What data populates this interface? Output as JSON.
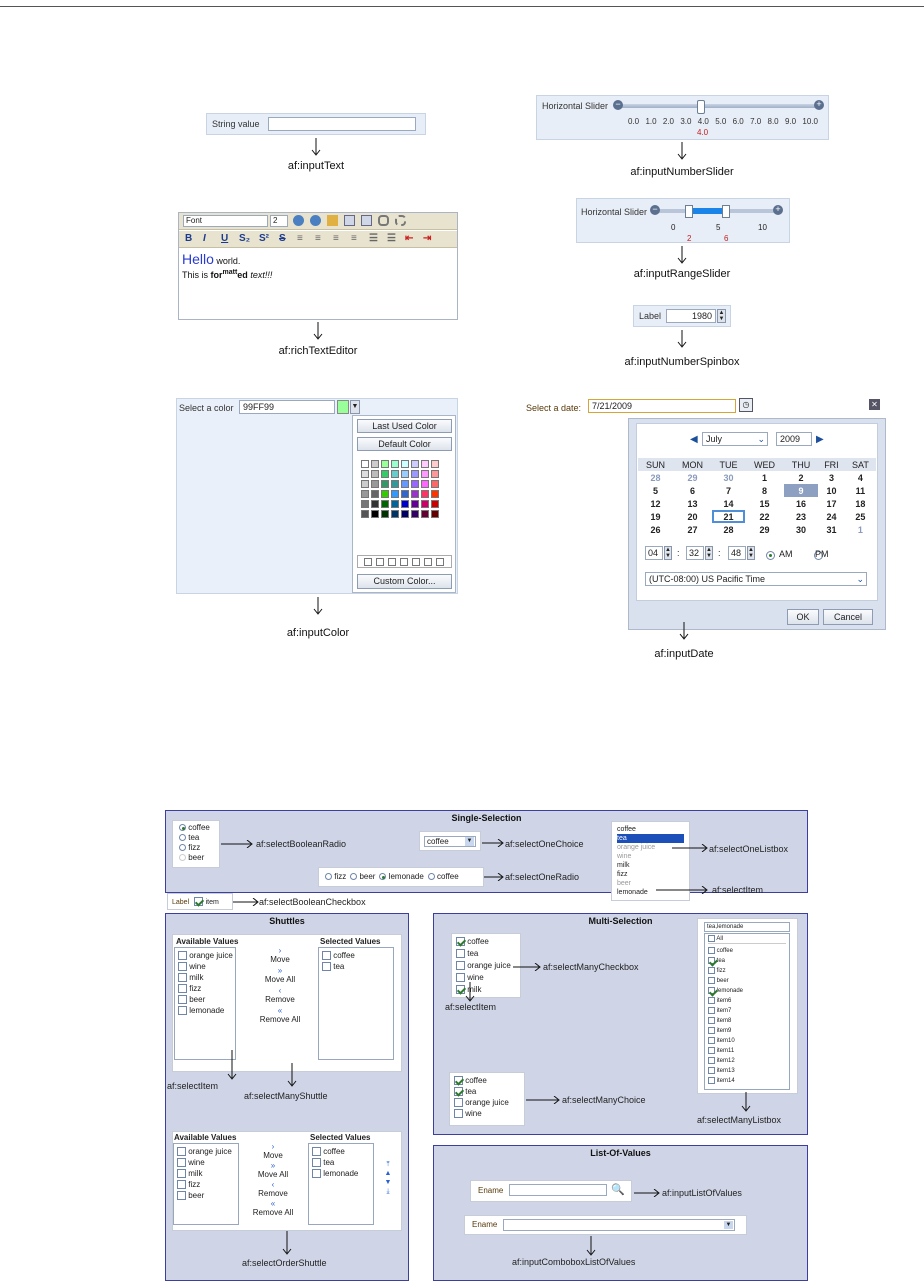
{
  "input_text": {
    "label": "String value",
    "caption": "af:inputText"
  },
  "number_slider": {
    "label": "Horizontal Slider",
    "ticks": [
      "0.0",
      "1.0",
      "2.0",
      "3.0",
      "4.0",
      "5.0",
      "6.0",
      "7.0",
      "8.0",
      "9.0",
      "10.0"
    ],
    "value": "4.0",
    "caption": "af:inputNumberSlider"
  },
  "range_slider": {
    "label": "Horizontal Slider",
    "ticks": [
      "0",
      "5",
      "10"
    ],
    "low": "2",
    "high": "6",
    "caption": "af:inputRangeSlider"
  },
  "rich_text": {
    "font_label": "Font",
    "size": "2",
    "hello": "Hello",
    "world": " world.",
    "line2_a": "This is ",
    "line2_b": "for",
    "line2_c": "matt",
    "line2_d": "ed",
    "line2_e": " text!!!",
    "caption": "af:richTextEditor"
  },
  "spinbox": {
    "label": "Label",
    "value": "1980",
    "caption": "af:inputNumberSpinbox"
  },
  "input_color": {
    "label": "Select a color",
    "value": "99FF99",
    "last_used": "Last Used Color",
    "default": "Default Color",
    "custom": "Custom Color...",
    "caption": "af:inputColor"
  },
  "input_date": {
    "label": "Select a date:",
    "value": "7/21/2009",
    "month": "July",
    "year": "2009",
    "days": [
      "SUN",
      "MON",
      "TUE",
      "WED",
      "THU",
      "FRI",
      "SAT"
    ],
    "weeks": [
      [
        "28",
        "29",
        "30",
        "1",
        "2",
        "3",
        "4"
      ],
      [
        "5",
        "6",
        "7",
        "8",
        "9",
        "10",
        "11"
      ],
      [
        "12",
        "13",
        "14",
        "15",
        "16",
        "17",
        "18"
      ],
      [
        "19",
        "20",
        "21",
        "22",
        "23",
        "24",
        "25"
      ],
      [
        "26",
        "27",
        "28",
        "29",
        "30",
        "31",
        "1"
      ]
    ],
    "hour": "04",
    "minute": "32",
    "second": "48",
    "am": "AM",
    "pm": "PM",
    "timezone": "(UTC-08:00) US Pacific Time",
    "ok": "OK",
    "cancel": "Cancel",
    "caption": "af:inputDate"
  },
  "single_selection": {
    "title": "Single-Selection",
    "radio_items": [
      "coffee",
      "tea",
      "fizz",
      "beer"
    ],
    "boolean_radio": "af:selectBooleanRadio",
    "choice_value": "coffee",
    "one_choice": "af:selectOneChoice",
    "one_radio_items": [
      "fizz",
      "beer",
      "lemonade",
      "coffee"
    ],
    "one_radio": "af:selectOneRadio",
    "checkbox_label": "Label",
    "checkbox_item": "item",
    "boolean_checkbox": "af:selectBooleanCheckbox",
    "listbox_items": [
      "coffee",
      "tea",
      "orange juice",
      "wine",
      "milk",
      "fizz",
      "beer",
      "lemonade"
    ],
    "one_listbox": "af:selectOneListbox",
    "select_item": "af:selectItem"
  },
  "shuttles": {
    "title": "Shuttles",
    "available": "Available Values",
    "selected": "Selected Values",
    "left_items": [
      "orange juice",
      "wine",
      "milk",
      "fizz",
      "beer",
      "lemonade"
    ],
    "right_items": [
      "coffee",
      "tea"
    ],
    "move": "Move",
    "move_all": "Move All",
    "remove": "Remove",
    "remove_all": "Remove All",
    "select_item": "af:selectItem",
    "many_shuttle": "af:selectManyShuttle",
    "order_left": [
      "orange juice",
      "wine",
      "milk",
      "fizz",
      "beer"
    ],
    "order_right": [
      "coffee",
      "tea",
      "lemonade"
    ],
    "order_shuttle": "af:selectOrderShuttle"
  },
  "multi_selection": {
    "title": "Multi-Selection",
    "checkbox_items": [
      "coffee",
      "tea",
      "orange juice",
      "wine",
      "milk"
    ],
    "many_checkbox": "af:selectManyCheckbox",
    "select_item": "af:selectItem",
    "choice_items": [
      "coffee",
      "tea",
      "orange juice",
      "wine"
    ],
    "many_choice": "af:selectManyChoice",
    "listbox_value": "tea,lemonade",
    "listbox_all": "All",
    "listbox_items": [
      "coffee",
      "tea",
      "fizz",
      "beer",
      "lemonade",
      "item6",
      "item7",
      "item8",
      "item9",
      "item10",
      "item11",
      "item12",
      "item13",
      "item14"
    ],
    "many_listbox": "af:selectManyListbox"
  },
  "lov": {
    "title": "List-Of-Values",
    "ename": "Ename",
    "input_lov": "af:inputListOfValues",
    "combo_lov": "af:inputComboboxListOfValues"
  }
}
